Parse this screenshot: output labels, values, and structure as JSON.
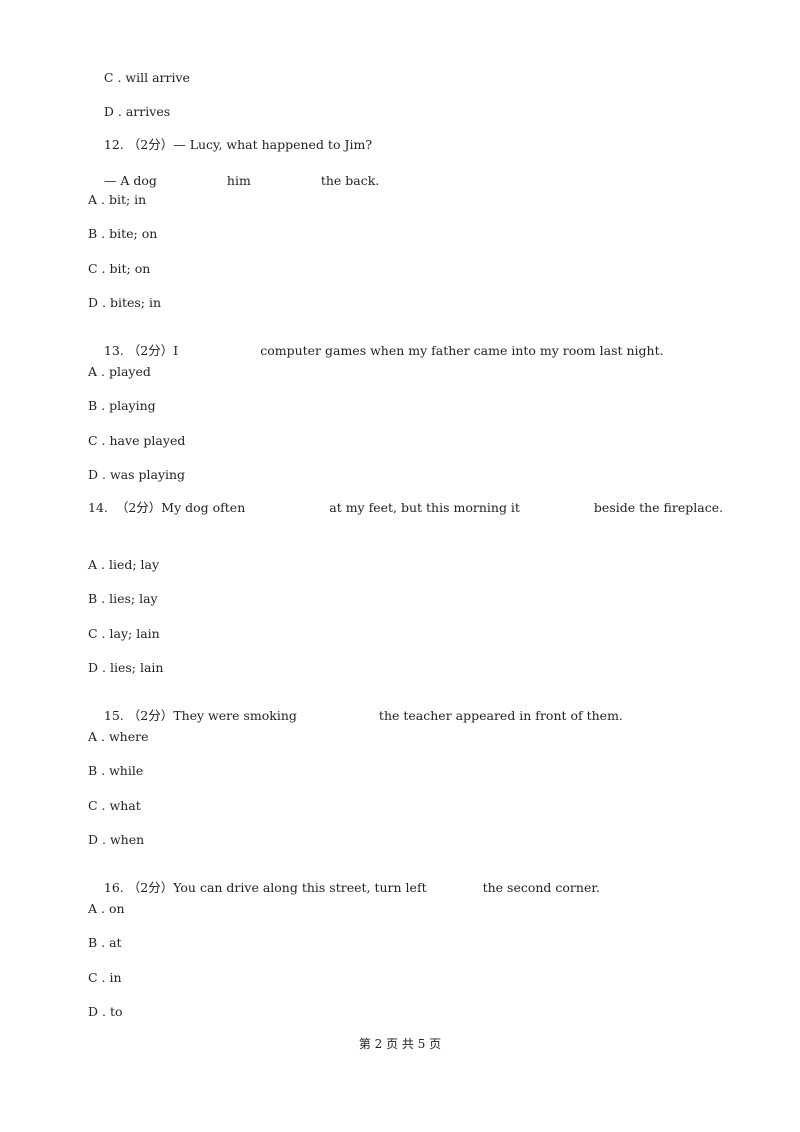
{
  "page": {
    "prev_question_tail": {
      "options": [
        {
          "letter": "C",
          "text": "will arrive"
        },
        {
          "letter": "D",
          "text": "arrives"
        }
      ]
    },
    "questions": [
      {
        "number": "12.",
        "score": "（2分）",
        "stem_parts": [
          "— Lucy, what happened to Jim?"
        ],
        "stem_line2_parts": [
          "— A dog",
          "him",
          "the back."
        ],
        "options": [
          {
            "letter": "A",
            "text": "bit; in"
          },
          {
            "letter": "B",
            "text": "bite; on"
          },
          {
            "letter": "C",
            "text": "bit; on"
          },
          {
            "letter": "D",
            "text": "bites; in"
          }
        ]
      },
      {
        "number": "13.",
        "score": "（2分）",
        "stem_parts": [
          "I",
          "computer games when my father came into my room last night."
        ],
        "options": [
          {
            "letter": "A",
            "text": "played"
          },
          {
            "letter": "B",
            "text": "playing"
          },
          {
            "letter": "C",
            "text": "have played"
          },
          {
            "letter": "D",
            "text": "was playing"
          }
        ]
      },
      {
        "number": "14.",
        "score": "（2分）",
        "stem_parts": [
          "My dog often",
          "at my feet, but this morning it",
          "beside the fireplace."
        ],
        "options": [
          {
            "letter": "A",
            "text": "lied; lay"
          },
          {
            "letter": "B",
            "text": "lies; lay"
          },
          {
            "letter": "C",
            "text": "lay; lain"
          },
          {
            "letter": "D",
            "text": "lies; lain"
          }
        ]
      },
      {
        "number": "15.",
        "score": "（2分）",
        "stem_parts": [
          "They were smoking",
          "the teacher appeared in front of them."
        ],
        "options": [
          {
            "letter": "A",
            "text": "where"
          },
          {
            "letter": "B",
            "text": "while"
          },
          {
            "letter": "C",
            "text": "what"
          },
          {
            "letter": "D",
            "text": "when"
          }
        ]
      },
      {
        "number": "16.",
        "score": "（2分）",
        "stem_parts": [
          "You can drive along this street, turn left",
          "the second corner."
        ],
        "options": [
          {
            "letter": "A",
            "text": "on"
          },
          {
            "letter": "B",
            "text": "at"
          },
          {
            "letter": "C",
            "text": "in"
          },
          {
            "letter": "D",
            "text": "to"
          }
        ]
      }
    ],
    "footer": "第 2 页 共 5 页"
  }
}
